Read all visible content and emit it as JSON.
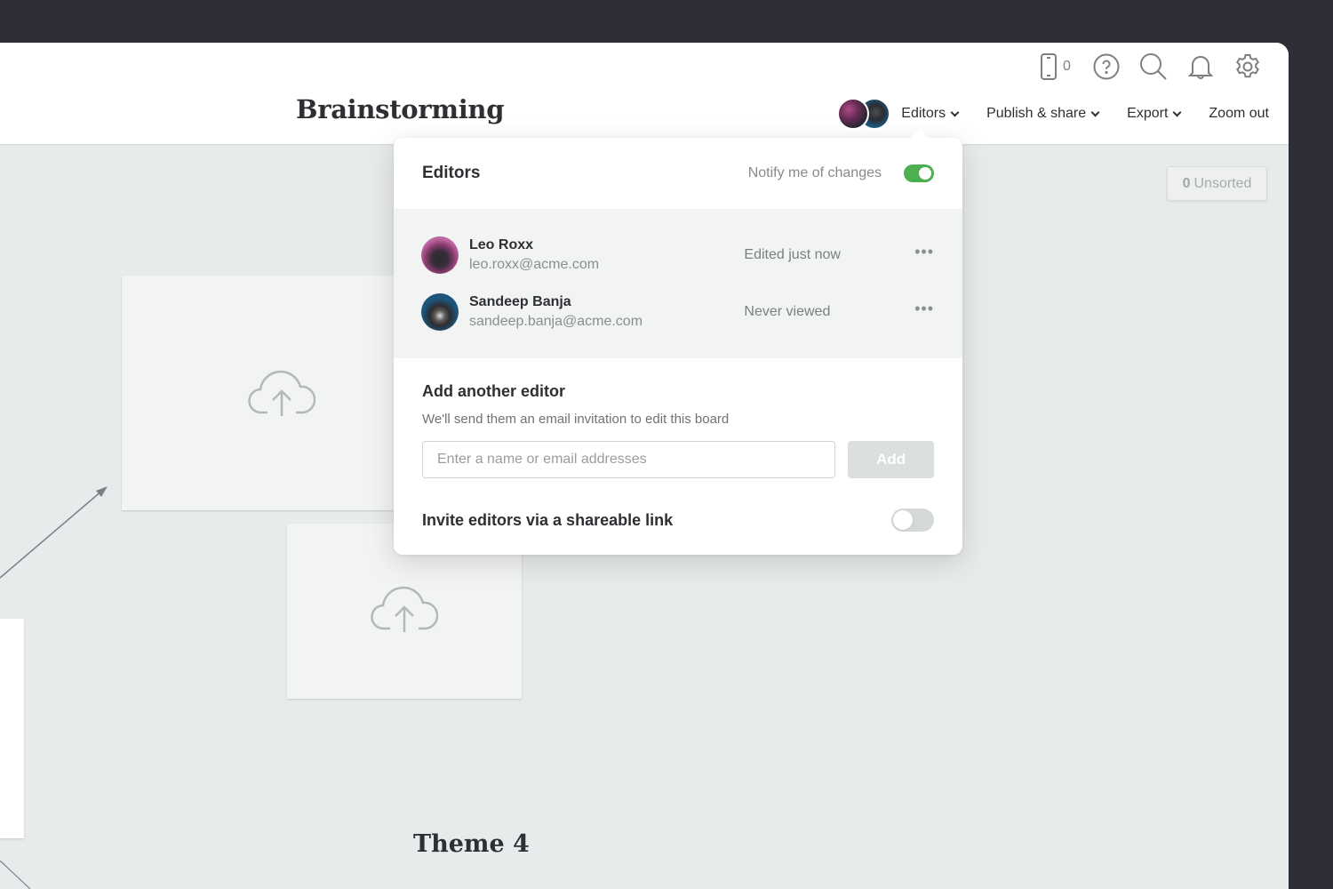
{
  "header": {
    "board_title": "Brainstorming",
    "mobile_count": "0",
    "icons": [
      "mobile-icon",
      "help-icon",
      "search-icon",
      "bell-icon",
      "gear-icon"
    ],
    "nav": {
      "editors_label": "Editors",
      "publish_label": "Publish & share",
      "export_label": "Export",
      "zoom_label": "Zoom out"
    }
  },
  "canvas": {
    "unsorted_count": "0",
    "unsorted_label": "Unsorted",
    "theme_title": "Theme 4"
  },
  "popover": {
    "title": "Editors",
    "notify_label": "Notify me of changes",
    "notify_on": true,
    "editors": [
      {
        "name": "Leo Roxx",
        "email": "leo.roxx@acme.com",
        "status": "Edited just now"
      },
      {
        "name": "Sandeep Banja",
        "email": "sandeep.banja@acme.com",
        "status": "Never viewed"
      }
    ],
    "add_title": "Add another editor",
    "add_desc": "We'll send them an email invitation to edit this board",
    "add_placeholder": "Enter a name or email addresses",
    "add_value": "",
    "add_button": "Add",
    "invite_label": "Invite editors via a shareable link",
    "invite_on": false
  },
  "colors": {
    "accent_green": "#4caf50",
    "background_dark": "#2e2e37",
    "canvas": "#e8ebeb"
  }
}
